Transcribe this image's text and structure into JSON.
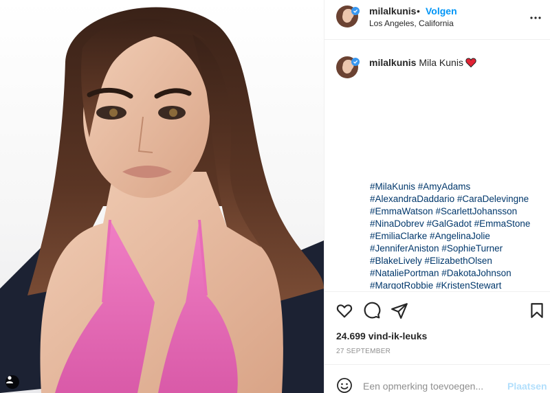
{
  "post": {
    "image_alt": "Mila Kunis portrait",
    "user_tag_icon": "person-icon"
  },
  "header": {
    "username": "milalkunis",
    "separator": "•",
    "follow_label": "Volgen",
    "location": "Los Angeles, California",
    "verified": true,
    "more_icon": "more-options-icon"
  },
  "caption": {
    "username": "milalkunis",
    "text": "Mila Kunis",
    "emoji": "red-heart-icon",
    "hashtag_lines": [
      "#MilaKunis #AmyAdams",
      "#AlexandraDaddario #CaraDelevingne",
      "#EmmaWatson #ScarlettJohansson",
      "#NinaDobrev #GalGadot #EmmaStone",
      "#EmiliaClarke #AngelinaJolie",
      "#JenniferAniston #SophieTurner",
      "#BlakeLively #ElizabethOlsen",
      "#NataliePortman #DakotaJohnson",
      "#MargotRobbie #KristenStewart"
    ]
  },
  "actions": {
    "icons": [
      "heart-icon",
      "comment-icon",
      "share-icon",
      "bookmark-icon"
    ]
  },
  "stats": {
    "likes": "24.699 vind-ik-leuks",
    "date": "27 SEPTEMBER"
  },
  "comment": {
    "placeholder": "Een opmerking toevoegen...",
    "post_label": "Plaatsen"
  },
  "colors": {
    "accent": "#0095f6",
    "hashtag": "#00376b",
    "heart": "#ed4956",
    "muted": "#8e8e8e",
    "post_disabled": "#b2dffc"
  }
}
